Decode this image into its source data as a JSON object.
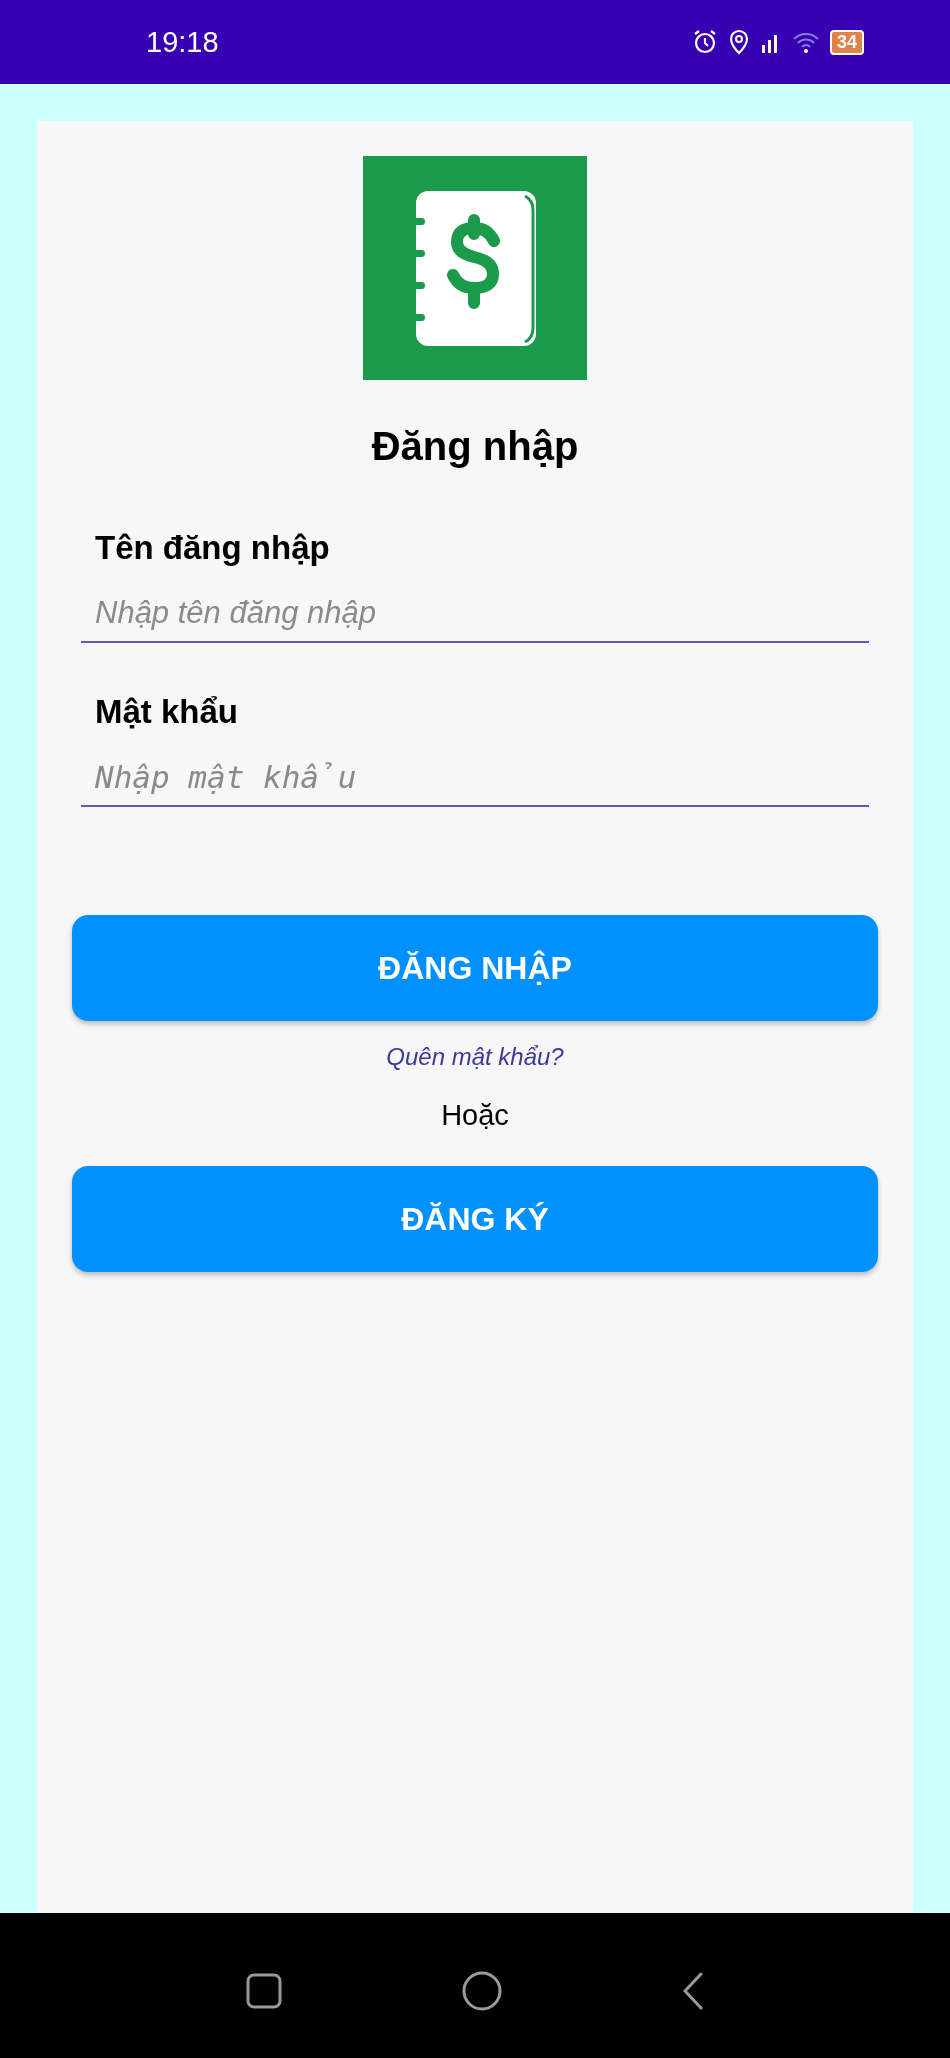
{
  "status_bar": {
    "time": "19:18",
    "battery": "34"
  },
  "title": "Đăng nhập",
  "fields": [
    {
      "label": "Tên đăng nhập",
      "placeholder": "Nhập tên đăng nhập",
      "kind": "text"
    },
    {
      "label": "Mật khẩu",
      "placeholder": "Nhập mật khẩu",
      "kind": "password"
    }
  ],
  "login_button": "ĐĂNG NHẬP",
  "forgot_link": "Quên mật khẩu?",
  "separator": "Hoặc",
  "register_button": "ĐĂNG KÝ"
}
